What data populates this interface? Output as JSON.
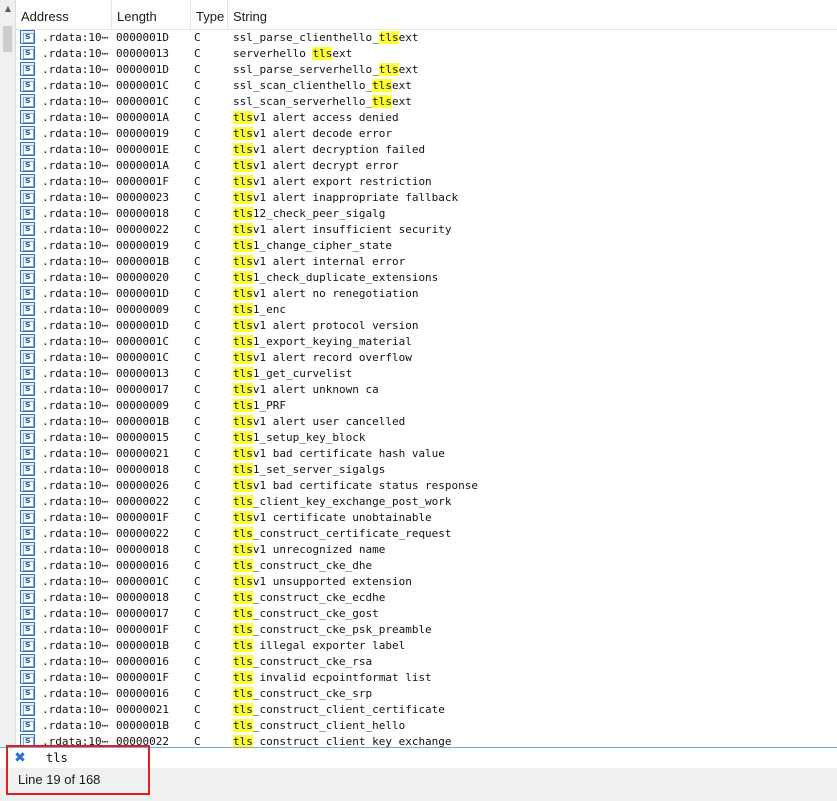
{
  "columns": {
    "address": "Address",
    "length": "Length",
    "type": "Type",
    "string": "String"
  },
  "search": {
    "query": "tls"
  },
  "status": {
    "text": "Line 19 of 168"
  },
  "colors": {
    "highlight": "#ffff33",
    "icon": "#2f6fbf",
    "annotation_box": "#e02020"
  },
  "rows": [
    {
      "address": ".rdata:10⋯",
      "length": "0000001D",
      "type": "C",
      "pre": "ssl_parse_clienthello_",
      "match": "tls",
      "post": "ext"
    },
    {
      "address": ".rdata:10⋯",
      "length": "00000013",
      "type": "C",
      "pre": "serverhello ",
      "match": "tls",
      "post": "ext"
    },
    {
      "address": ".rdata:10⋯",
      "length": "0000001D",
      "type": "C",
      "pre": "ssl_parse_serverhello_",
      "match": "tls",
      "post": "ext"
    },
    {
      "address": ".rdata:10⋯",
      "length": "0000001C",
      "type": "C",
      "pre": "ssl_scan_clienthello_",
      "match": "tls",
      "post": "ext"
    },
    {
      "address": ".rdata:10⋯",
      "length": "0000001C",
      "type": "C",
      "pre": "ssl_scan_serverhello_",
      "match": "tls",
      "post": "ext"
    },
    {
      "address": ".rdata:10⋯",
      "length": "0000001A",
      "type": "C",
      "pre": "",
      "match": "tls",
      "post": "v1 alert access denied"
    },
    {
      "address": ".rdata:10⋯",
      "length": "00000019",
      "type": "C",
      "pre": "",
      "match": "tls",
      "post": "v1 alert decode error"
    },
    {
      "address": ".rdata:10⋯",
      "length": "0000001E",
      "type": "C",
      "pre": "",
      "match": "tls",
      "post": "v1 alert decryption failed"
    },
    {
      "address": ".rdata:10⋯",
      "length": "0000001A",
      "type": "C",
      "pre": "",
      "match": "tls",
      "post": "v1 alert decrypt error"
    },
    {
      "address": ".rdata:10⋯",
      "length": "0000001F",
      "type": "C",
      "pre": "",
      "match": "tls",
      "post": "v1 alert export restriction"
    },
    {
      "address": ".rdata:10⋯",
      "length": "00000023",
      "type": "C",
      "pre": "",
      "match": "tls",
      "post": "v1 alert inappropriate fallback"
    },
    {
      "address": ".rdata:10⋯",
      "length": "00000018",
      "type": "C",
      "pre": "",
      "match": "tls",
      "post": "12_check_peer_sigalg"
    },
    {
      "address": ".rdata:10⋯",
      "length": "00000022",
      "type": "C",
      "pre": "",
      "match": "tls",
      "post": "v1 alert insufficient security"
    },
    {
      "address": ".rdata:10⋯",
      "length": "00000019",
      "type": "C",
      "pre": "",
      "match": "tls",
      "post": "1_change_cipher_state"
    },
    {
      "address": ".rdata:10⋯",
      "length": "0000001B",
      "type": "C",
      "pre": "",
      "match": "tls",
      "post": "v1 alert internal error"
    },
    {
      "address": ".rdata:10⋯",
      "length": "00000020",
      "type": "C",
      "pre": "",
      "match": "tls",
      "post": "1_check_duplicate_extensions"
    },
    {
      "address": ".rdata:10⋯",
      "length": "0000001D",
      "type": "C",
      "pre": "",
      "match": "tls",
      "post": "v1 alert no renegotiation"
    },
    {
      "address": ".rdata:10⋯",
      "length": "00000009",
      "type": "C",
      "pre": "",
      "match": "tls",
      "post": "1_enc"
    },
    {
      "address": ".rdata:10⋯",
      "length": "0000001D",
      "type": "C",
      "pre": "",
      "match": "tls",
      "post": "v1 alert protocol version"
    },
    {
      "address": ".rdata:10⋯",
      "length": "0000001C",
      "type": "C",
      "pre": "",
      "match": "tls",
      "post": "1_export_keying_material"
    },
    {
      "address": ".rdata:10⋯",
      "length": "0000001C",
      "type": "C",
      "pre": "",
      "match": "tls",
      "post": "v1 alert record overflow"
    },
    {
      "address": ".rdata:10⋯",
      "length": "00000013",
      "type": "C",
      "pre": "",
      "match": "tls",
      "post": "1_get_curvelist"
    },
    {
      "address": ".rdata:10⋯",
      "length": "00000017",
      "type": "C",
      "pre": "",
      "match": "tls",
      "post": "v1 alert unknown ca"
    },
    {
      "address": ".rdata:10⋯",
      "length": "00000009",
      "type": "C",
      "pre": "",
      "match": "tls",
      "post": "1_PRF"
    },
    {
      "address": ".rdata:10⋯",
      "length": "0000001B",
      "type": "C",
      "pre": "",
      "match": "tls",
      "post": "v1 alert user cancelled"
    },
    {
      "address": ".rdata:10⋯",
      "length": "00000015",
      "type": "C",
      "pre": "",
      "match": "tls",
      "post": "1_setup_key_block"
    },
    {
      "address": ".rdata:10⋯",
      "length": "00000021",
      "type": "C",
      "pre": "",
      "match": "tls",
      "post": "v1 bad certificate hash value"
    },
    {
      "address": ".rdata:10⋯",
      "length": "00000018",
      "type": "C",
      "pre": "",
      "match": "tls",
      "post": "1_set_server_sigalgs"
    },
    {
      "address": ".rdata:10⋯",
      "length": "00000026",
      "type": "C",
      "pre": "",
      "match": "tls",
      "post": "v1 bad certificate status response"
    },
    {
      "address": ".rdata:10⋯",
      "length": "00000022",
      "type": "C",
      "pre": "",
      "match": "tls",
      "post": "_client_key_exchange_post_work"
    },
    {
      "address": ".rdata:10⋯",
      "length": "0000001F",
      "type": "C",
      "pre": "",
      "match": "tls",
      "post": "v1 certificate unobtainable"
    },
    {
      "address": ".rdata:10⋯",
      "length": "00000022",
      "type": "C",
      "pre": "",
      "match": "tls",
      "post": "_construct_certificate_request"
    },
    {
      "address": ".rdata:10⋯",
      "length": "00000018",
      "type": "C",
      "pre": "",
      "match": "tls",
      "post": "v1 unrecognized name"
    },
    {
      "address": ".rdata:10⋯",
      "length": "00000016",
      "type": "C",
      "pre": "",
      "match": "tls",
      "post": "_construct_cke_dhe"
    },
    {
      "address": ".rdata:10⋯",
      "length": "0000001C",
      "type": "C",
      "pre": "",
      "match": "tls",
      "post": "v1 unsupported extension"
    },
    {
      "address": ".rdata:10⋯",
      "length": "00000018",
      "type": "C",
      "pre": "",
      "match": "tls",
      "post": "_construct_cke_ecdhe"
    },
    {
      "address": ".rdata:10⋯",
      "length": "00000017",
      "type": "C",
      "pre": "",
      "match": "tls",
      "post": "_construct_cke_gost"
    },
    {
      "address": ".rdata:10⋯",
      "length": "0000001F",
      "type": "C",
      "pre": "",
      "match": "tls",
      "post": "_construct_cke_psk_preamble"
    },
    {
      "address": ".rdata:10⋯",
      "length": "0000001B",
      "type": "C",
      "pre": "",
      "match": "tls",
      "post": " illegal exporter label"
    },
    {
      "address": ".rdata:10⋯",
      "length": "00000016",
      "type": "C",
      "pre": "",
      "match": "tls",
      "post": "_construct_cke_rsa"
    },
    {
      "address": ".rdata:10⋯",
      "length": "0000001F",
      "type": "C",
      "pre": "",
      "match": "tls",
      "post": " invalid ecpointformat list"
    },
    {
      "address": ".rdata:10⋯",
      "length": "00000016",
      "type": "C",
      "pre": "",
      "match": "tls",
      "post": "_construct_cke_srp"
    },
    {
      "address": ".rdata:10⋯",
      "length": "00000021",
      "type": "C",
      "pre": "",
      "match": "tls",
      "post": "_construct_client_certificate"
    },
    {
      "address": ".rdata:10⋯",
      "length": "0000001B",
      "type": "C",
      "pre": "",
      "match": "tls",
      "post": "_construct_client_hello"
    },
    {
      "address": ".rdata:10⋯",
      "length": "00000022",
      "type": "C",
      "pre": "",
      "match": "tls",
      "post": "_construct_client_key_exchange"
    }
  ]
}
